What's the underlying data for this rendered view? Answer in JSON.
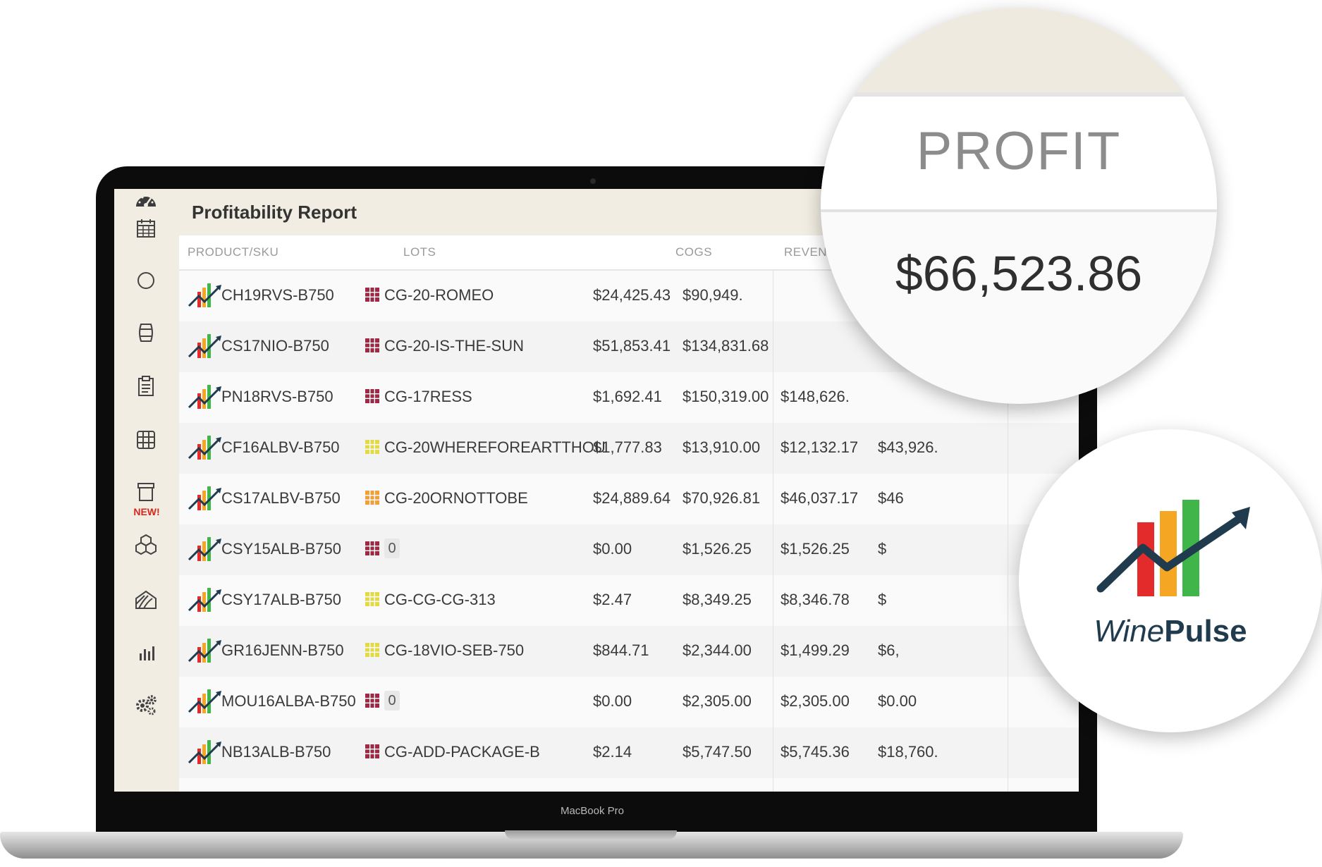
{
  "app": {
    "title": "Profitability Report",
    "new_badge": "NEW!"
  },
  "device": {
    "label": "MacBook Pro"
  },
  "sidebar": {
    "items": [
      {
        "icon": "dashboard-gauge-icon"
      },
      {
        "icon": "calendar-icon"
      },
      {
        "icon": "circle-icon"
      },
      {
        "icon": "barrel-icon"
      },
      {
        "icon": "clipboard-icon"
      },
      {
        "icon": "grid-table-icon"
      },
      {
        "icon": "bin-icon"
      },
      {
        "icon": "cases-boxes-icon"
      },
      {
        "icon": "vineyard-icon"
      },
      {
        "icon": "bar-chart-icon"
      },
      {
        "icon": "settings-gears-icon"
      }
    ]
  },
  "table": {
    "headers": {
      "product": "PRODUCT/SKU",
      "lots": "LOTS",
      "cogs": "COGS",
      "revenue": "REVENUE"
    },
    "rows": [
      {
        "sku": "CH19RVS-B750",
        "lot": "CG-20-ROMEO",
        "lot_color": "#9c2a45",
        "cogs": "$24,425.43",
        "revenue": "$90,949."
      },
      {
        "sku": "CS17NIO-B750",
        "lot": "CG-20-IS-THE-SUN",
        "lot_color": "#9c2a45",
        "cogs": "$51,853.41",
        "revenue": "$134,831.68"
      },
      {
        "sku": "PN18RVS-B750",
        "lot": "CG-17RESS",
        "lot_color": "#9c2a45",
        "cogs": "$1,692.41",
        "revenue": "$150,319.00",
        "profit": "$148,626."
      },
      {
        "sku": "CF16ALBV-B750",
        "lot": "CG-20WHEREFOREARTTHOU",
        "lot_color": "#e2d94a",
        "cogs": "$1,777.83",
        "revenue": "$13,910.00",
        "profit": "$12,132.17",
        "extra": "$43,926."
      },
      {
        "sku": "CS17ALBV-B750",
        "lot": "CG-20ORNOTTOBE",
        "lot_color": "#f0a03a",
        "cogs": "$24,889.64",
        "revenue": "$70,926.81",
        "profit": "$46,037.17",
        "extra": "$46"
      },
      {
        "sku": "CSY15ALB-B750",
        "lot": "0",
        "lot_is_badge": true,
        "lot_color": "#9c2a45",
        "cogs": "$0.00",
        "revenue": "$1,526.25",
        "profit": "$1,526.25",
        "extra": "$"
      },
      {
        "sku": "CSY17ALB-B750",
        "lot": "CG-CG-CG-313",
        "lot_color": "#e2d94a",
        "cogs": "$2.47",
        "revenue": "$8,349.25",
        "profit": "$8,346.78",
        "extra": "$"
      },
      {
        "sku": "GR16JENN-B750",
        "lot": "CG-18VIO-SEB-750",
        "lot_color": "#e2d94a",
        "cogs": "$844.71",
        "revenue": "$2,344.00",
        "profit": "$1,499.29",
        "extra": "$6,"
      },
      {
        "sku": "MOU16ALBA-B750",
        "lot": "0",
        "lot_is_badge": true,
        "lot_color": "#9c2a45",
        "cogs": "$0.00",
        "revenue": "$2,305.00",
        "profit": "$2,305.00",
        "extra": "$0.00"
      },
      {
        "sku": "NB13ALB-B750",
        "lot": "CG-ADD-PACKAGE-B",
        "lot_color": "#9c2a45",
        "cogs": "$2.14",
        "revenue": "$5,747.50",
        "profit": "$5,745.36",
        "extra": "$18,760."
      }
    ]
  },
  "zoom": {
    "label": "PROFIT",
    "value": "$66,523.86"
  },
  "brand": {
    "name_part1": "Wine",
    "name_part2": "Pulse",
    "colors": [
      "#e32b2b",
      "#f5a623",
      "#3fb54a",
      "#1f3b4d"
    ]
  }
}
